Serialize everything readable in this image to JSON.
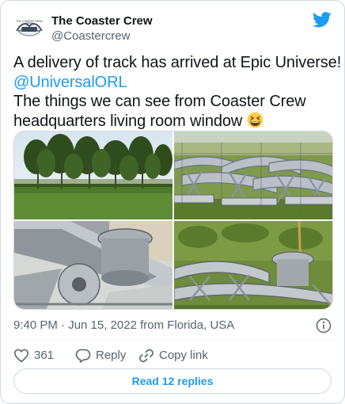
{
  "author": {
    "name": "The Coaster Crew",
    "handle": "@Coastercrew",
    "avatar_icon": "coaster-crew-logo",
    "avatar_logo_text": "THE COASTER CREW"
  },
  "brand": {
    "icon": "twitter-bird-icon",
    "color": "#1d9bf0"
  },
  "tweet": {
    "line1": "A delivery of track has arrived at Epic Universe!",
    "mention": "@UniversalORL",
    "line3": "The things we can see from Coaster Crew",
    "line4": "headquarters living room window",
    "emoji": "grinning-squinting-face"
  },
  "media": {
    "count": 4,
    "photos": [
      {
        "subject": "tall bamboo trees behind grass"
      },
      {
        "subject": "grey roller coaster track pieces behind fence"
      },
      {
        "subject": "close-up of coaster track flanges"
      },
      {
        "subject": "stacked coaster track pieces in grass"
      }
    ]
  },
  "meta": {
    "timestamp": "9:40 PM · Jun 15, 2022 from Florida, USA",
    "info_icon": "info-icon"
  },
  "actions": {
    "like_count": "361",
    "reply_label": "Reply",
    "copy_label": "Copy link"
  },
  "replies_button": "Read 12 replies",
  "colors": {
    "text": "#0f1419",
    "secondary": "#536471",
    "accent": "#1d9bf0",
    "border": "#cfd9de"
  }
}
